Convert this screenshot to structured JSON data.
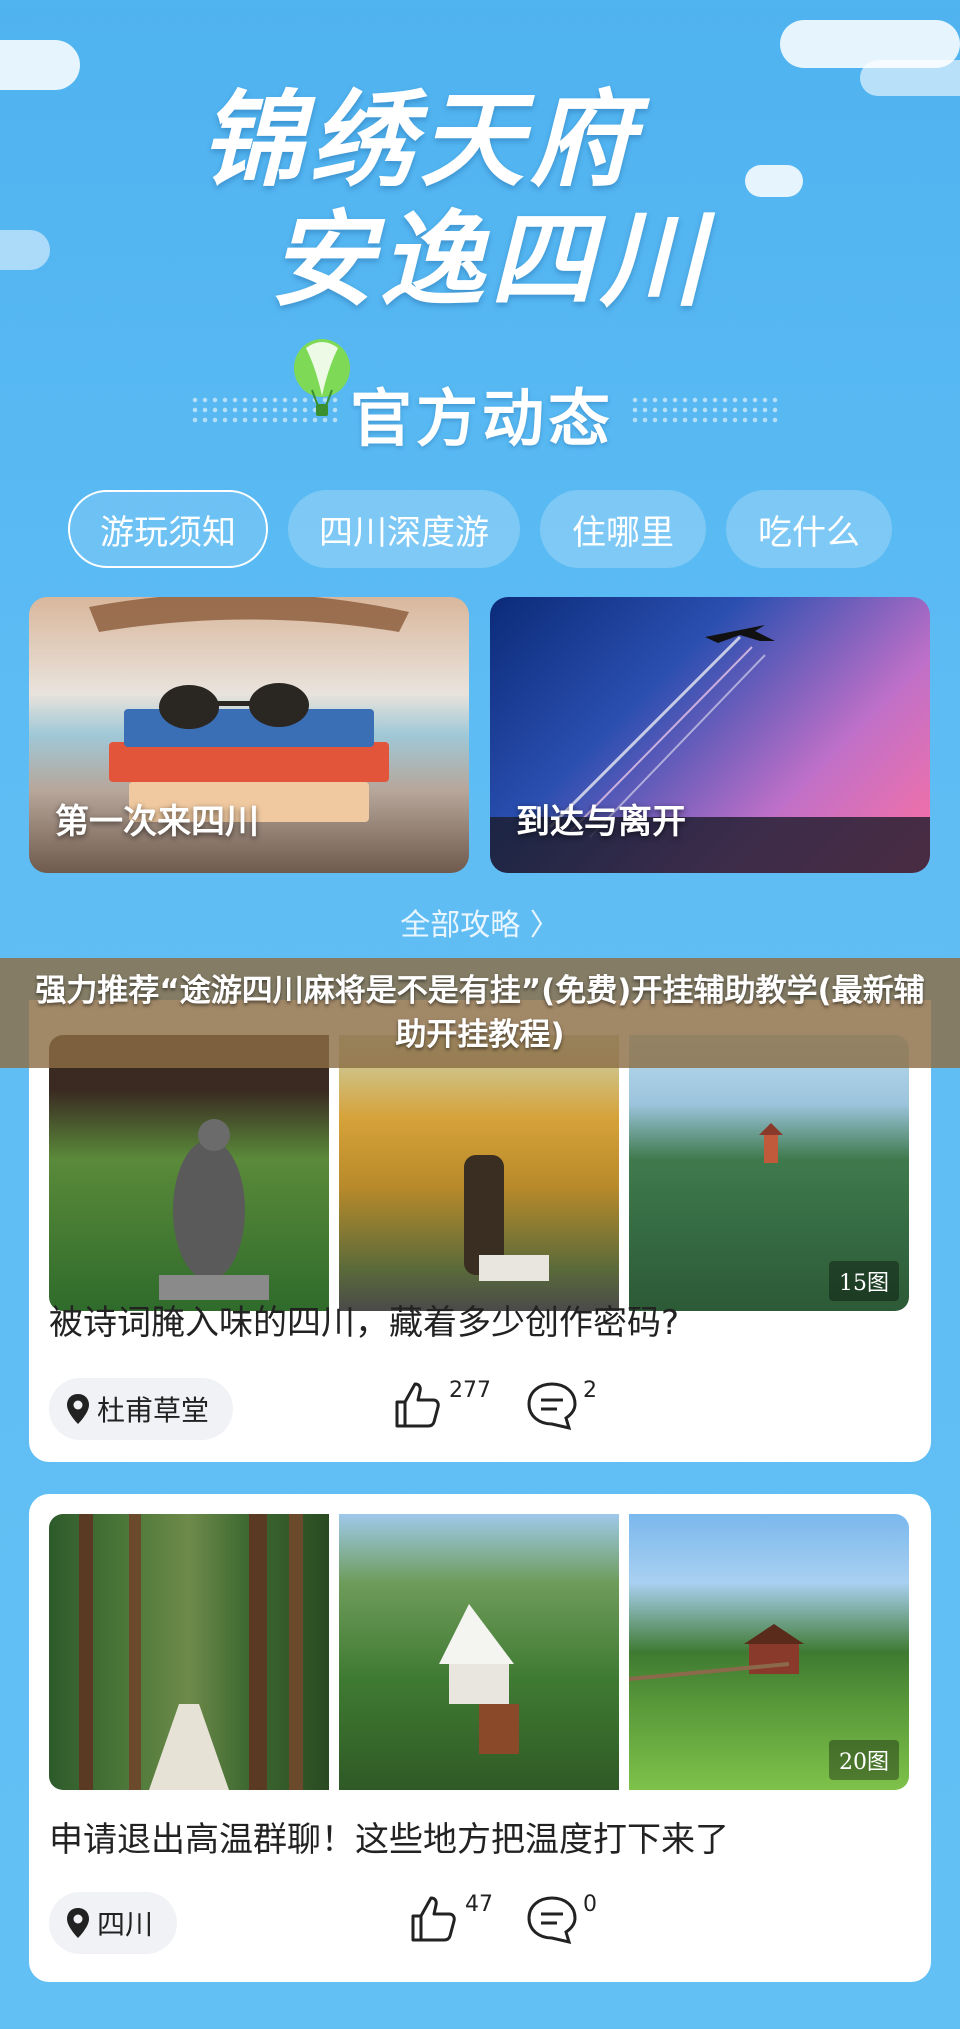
{
  "hero": {
    "line1": "锦绣天府",
    "line2": "安逸四川",
    "subtitle": "官方动态"
  },
  "tabs": [
    {
      "label": "游玩须知",
      "active": true
    },
    {
      "label": "四川深度游",
      "active": false
    },
    {
      "label": "住哪里",
      "active": false
    },
    {
      "label": "吃什么",
      "active": false
    }
  ],
  "features": [
    {
      "label": "第一次来四川"
    },
    {
      "label": "到达与离开"
    }
  ],
  "all_guide": "全部攻略 〉",
  "banner": "强力推荐“途游四川麻将是不是有挂”(免费)开挂辅助教学(最新辅助开挂教程)",
  "posts": [
    {
      "image_count": "15图",
      "title": "被诗词腌入味的四川，藏着多少创作密码?",
      "location": "杜甫草堂",
      "likes": "277",
      "comments": "2"
    },
    {
      "image_count": "20图",
      "title": "申请退出高温群聊！这些地方把温度打下来了",
      "location": "四川",
      "likes": "47",
      "comments": "0"
    }
  ],
  "colors": {
    "background": "#5fbdf4",
    "banner": "#8c6e46",
    "card": "#ffffff"
  }
}
